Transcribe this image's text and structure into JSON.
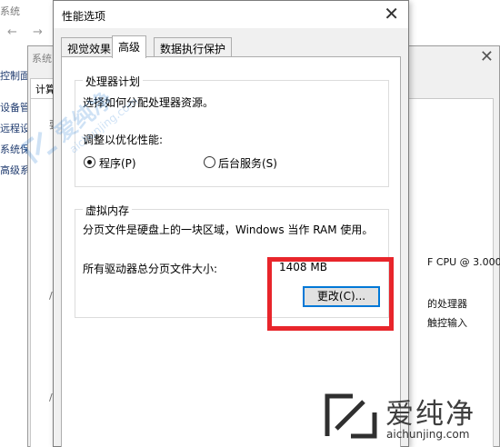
{
  "background_window": {
    "title": "系统",
    "nav_back": "←",
    "nav_forward": "→",
    "side_items": [
      "控制面",
      "设备管",
      "远程设",
      "系统保",
      "高级系"
    ]
  },
  "system_properties": {
    "title": "系统",
    "tab_fragment": "计算",
    "frag_a": "要",
    "frag_b": "/",
    "frag_c": "/",
    "cpu_text": "F CPU @ 3.000",
    "processor_text": "的处理器",
    "touch_text": "触控输入"
  },
  "dialog": {
    "title": "性能选项",
    "close_icon": "✕",
    "tabs": [
      {
        "label": "视觉效果",
        "active": false
      },
      {
        "label": "高级",
        "active": true
      },
      {
        "label": "数据执行保护",
        "active": false
      }
    ],
    "processor_group": {
      "legend": "处理器计划",
      "description": "选择如何分配处理器资源。",
      "adjust_label": "调整以优化性能:",
      "options": [
        {
          "label": "程序(P)",
          "checked": true
        },
        {
          "label": "后台服务(S)",
          "checked": false
        }
      ]
    },
    "virtual_memory_group": {
      "legend": "虚拟内存",
      "description": "分页文件是硬盘上的一块区域，Windows 当作 RAM 使用。",
      "total_label": "所有驱动器总分页文件大小:",
      "total_value": "1408 MB",
      "change_button": "更改(C)..."
    }
  },
  "highlight_color": "#e8252b",
  "watermark": {
    "small_text": "爱纯净",
    "small_sub": "aichunjing.com",
    "brand_text": "爱纯净",
    "brand_sub": "aichunjing.com"
  }
}
